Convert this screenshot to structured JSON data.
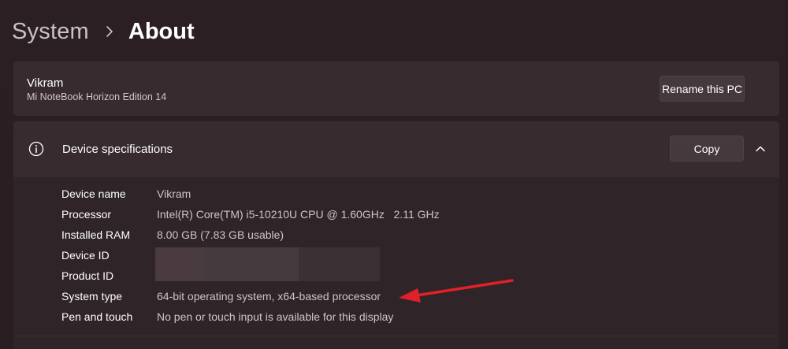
{
  "breadcrumb": {
    "parent": "System",
    "current": "About"
  },
  "pc": {
    "name": "Vikram",
    "model": "Mi NoteBook Horizon Edition 14",
    "rename_label": "Rename this PC"
  },
  "specs": {
    "title": "Device specifications",
    "copy_label": "Copy",
    "rows": [
      {
        "label": "Device name",
        "value": "Vikram"
      },
      {
        "label": "Processor",
        "value": "Intel(R) Core(TM) i5-10210U CPU @ 1.60GHz   2.11 GHz"
      },
      {
        "label": "Installed RAM",
        "value": "8.00 GB (7.83 GB usable)"
      },
      {
        "label": "Device ID",
        "value": ""
      },
      {
        "label": "Product ID",
        "value": ""
      },
      {
        "label": "System type",
        "value": "64-bit operating system, x64-based processor"
      },
      {
        "label": "Pen and touch",
        "value": "No pen or touch input is available for this display"
      }
    ]
  },
  "icons": {
    "info": "info-icon",
    "chevron_up": "chevron-up-icon",
    "breadcrumb_separator": "chevron-right-icon"
  },
  "colors": {
    "annotation_arrow": "#e0202a"
  }
}
